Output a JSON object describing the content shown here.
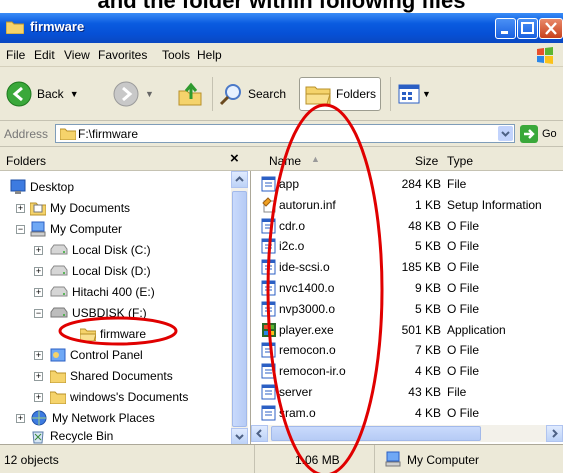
{
  "caption": "and the folder within following files",
  "window": {
    "title": "firmware"
  },
  "menu": [
    "File",
    "Edit",
    "View",
    "Favorites",
    "Tools",
    "Help"
  ],
  "toolbar": {
    "back": "Back",
    "search": "Search",
    "folders": "Folders"
  },
  "address": {
    "label": "Address",
    "value": "F:\\firmware",
    "go": "Go"
  },
  "folders_pane": {
    "title": "Folders",
    "tree": [
      {
        "label": "Desktop",
        "icon": "desktop-icon"
      },
      {
        "label": "My Documents",
        "icon": "my-documents-icon"
      },
      {
        "label": "My Computer",
        "icon": "my-computer-icon"
      },
      {
        "label": "Local Disk (C:)",
        "icon": "drive-icon"
      },
      {
        "label": "Local Disk (D:)",
        "icon": "drive-icon"
      },
      {
        "label": "Hitachi 400 (E:)",
        "icon": "drive-icon"
      },
      {
        "label": "USBDISK (F:)",
        "icon": "usb-drive-icon"
      },
      {
        "label": "firmware",
        "icon": "folder-open-icon"
      },
      {
        "label": "Control Panel",
        "icon": "control-panel-icon"
      },
      {
        "label": "Shared Documents",
        "icon": "folder-icon"
      },
      {
        "label": "windows's Documents",
        "icon": "folder-icon"
      },
      {
        "label": "My Network Places",
        "icon": "network-icon"
      },
      {
        "label": "Recycle Bin",
        "icon": "recycle-bin-icon"
      }
    ]
  },
  "files": {
    "columns": {
      "name": "Name",
      "size": "Size",
      "type": "Type"
    },
    "rows": [
      {
        "name": "app",
        "size": "284 KB",
        "type": "File",
        "icon": "file-icon"
      },
      {
        "name": "autorun.inf",
        "size": "1 KB",
        "type": "Setup Information",
        "icon": "setup-file-icon"
      },
      {
        "name": "cdr.o",
        "size": "48 KB",
        "type": "O File",
        "icon": "file-icon"
      },
      {
        "name": "i2c.o",
        "size": "5 KB",
        "type": "O File",
        "icon": "file-icon"
      },
      {
        "name": "ide-scsi.o",
        "size": "185 KB",
        "type": "O File",
        "icon": "file-icon"
      },
      {
        "name": "nvc1400.o",
        "size": "9 KB",
        "type": "O File",
        "icon": "file-icon"
      },
      {
        "name": "nvp3000.o",
        "size": "5 KB",
        "type": "O File",
        "icon": "file-icon"
      },
      {
        "name": "player.exe",
        "size": "501 KB",
        "type": "Application",
        "icon": "application-icon"
      },
      {
        "name": "remocon.o",
        "size": "7 KB",
        "type": "O File",
        "icon": "file-icon"
      },
      {
        "name": "remocon-ir.o",
        "size": "4 KB",
        "type": "O File",
        "icon": "file-icon"
      },
      {
        "name": "server",
        "size": "43 KB",
        "type": "File",
        "icon": "file-icon"
      },
      {
        "name": "sram.o",
        "size": "4 KB",
        "type": "O File",
        "icon": "file-icon"
      }
    ]
  },
  "status": {
    "objects": "12 objects",
    "size": "1.06 MB",
    "location": "My Computer"
  },
  "colors": {
    "title_bar": "#0a5be0",
    "chrome": "#ece9d8",
    "annotation": "#e00000"
  }
}
